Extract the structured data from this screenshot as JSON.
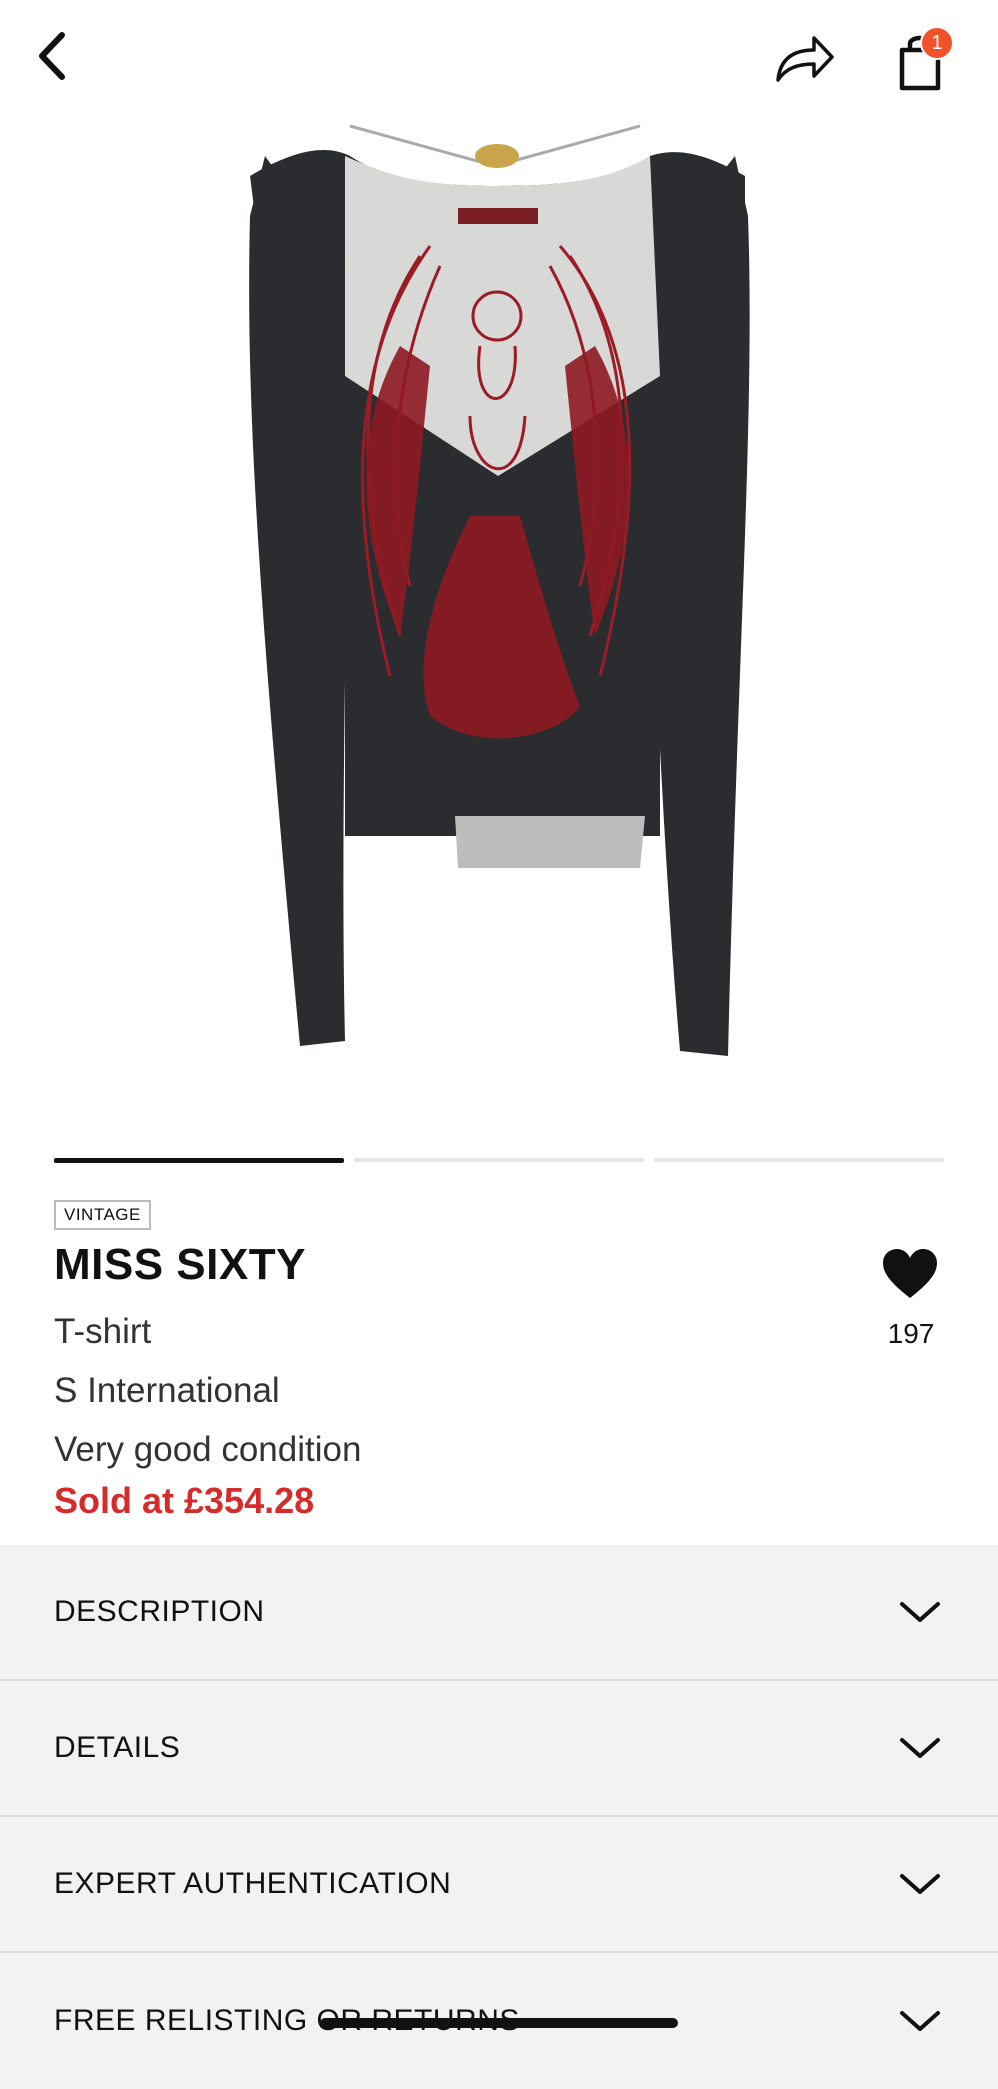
{
  "header": {
    "back_icon": "chevron-left-icon",
    "share_icon": "share-arrow-icon",
    "bag_icon": "shopping-bag-icon",
    "bag_count": "1",
    "badge_color": "#f0522a"
  },
  "gallery": {
    "image_alt": "Black long-sleeve top with red angel print",
    "page_count": 3,
    "active_index": 0
  },
  "product": {
    "tag": "VINTAGE",
    "brand": "MISS SIXTY",
    "type": "T-shirt",
    "size": "S International",
    "condition": "Very good condition",
    "price": "Sold at £354.28",
    "price_color": "#d52b2b",
    "likes": "197",
    "like_icon": "heart-icon"
  },
  "sections": [
    {
      "label": "DESCRIPTION"
    },
    {
      "label": "DETAILS"
    },
    {
      "label": "EXPERT AUTHENTICATION"
    },
    {
      "label": "FREE RELISTING OR RETURNS"
    }
  ]
}
